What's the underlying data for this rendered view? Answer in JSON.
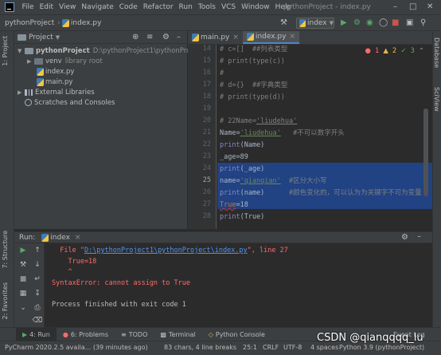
{
  "menu": {
    "items": [
      "File",
      "Edit",
      "View",
      "Navigate",
      "Code",
      "Refactor",
      "Run",
      "Tools",
      "VCS",
      "Window",
      "Help"
    ],
    "window_title": "pythonProject - index.py"
  },
  "nav": {
    "project": "pythonProject",
    "file": "index.py",
    "run_config": "index"
  },
  "left_tabs": {
    "project": "1: Project",
    "structure": "7: Structure",
    "favorites": "2: Favorites"
  },
  "right_tabs": {
    "database": "Database",
    "sciview": "SciView"
  },
  "project_panel": {
    "title": "Project",
    "root_name": "pythonProject",
    "root_path": "D:\\pythonProject1\\pythonProject",
    "venv": "venv",
    "venv_note": "library root",
    "file1": "index.py",
    "file2": "main.py",
    "external": "External Libraries",
    "scratches": "Scratches and Consoles"
  },
  "editor": {
    "tabs": [
      "main.py",
      "index.py"
    ],
    "inspections": {
      "errors": "1",
      "warnings": "2",
      "weak": "3"
    },
    "line_numbers": [
      "14",
      "15",
      "16",
      "17",
      "18",
      "19",
      "20",
      "21",
      "22",
      "23",
      "24",
      "25",
      "26",
      "27",
      "28"
    ],
    "lines": {
      "l14a": "# c=[]  ",
      "l14b": "##列表类型",
      "l15a": "# ",
      "l15b": "print",
      "l15c": "(",
      "l15d": "type",
      "l15e": "(c))",
      "l16": "#",
      "l17a": "# d={}  ",
      "l17b": "##字典类型",
      "l18a": "# ",
      "l18b": "print",
      "l18c": "(",
      "l18d": "type",
      "l18e": "(d))",
      "l20a": "# 22Name=",
      "l20b": "'liudehua'",
      "l21a": "Name=",
      "l21b": "'liudehua'",
      "l21c": "   #不可以数字开头",
      "l22a": "print",
      "l22b": "(Name)",
      "l23": "_age=89",
      "l24a": "print",
      "l24b": "(_age)",
      "l25a": "name=",
      "l25b": "'qianqian'",
      "l25c": "  #区分大小写",
      "l26a": "print",
      "l26b": "(name)",
      "l26c": "      #颜色变化的，可以认为为关键字不可为变量",
      "l27a": "True",
      "l27b": "=18",
      "l28a": "print",
      "l28b": "(True)"
    }
  },
  "run_panel": {
    "label": "Run:",
    "tab": "index",
    "out1a": "  File \"",
    "out1b": "D:\\pythonProject1\\pythonProject\\index.py",
    "out1c": "\", line 27",
    "out2": "    True=18",
    "out3": "    ^",
    "out4": "SyntaxError: cannot assign to True",
    "out5": "Process finished with exit code 1"
  },
  "bottom_tabs": [
    "4: Run",
    "6: Problems",
    "TODO",
    "Terminal",
    "Python Console",
    "Event Log"
  ],
  "status": {
    "left": "PyCharm 2020.2.5 availa... (39 minutes ago)",
    "chars": "83 chars, 4 line breaks",
    "pos": "25:1",
    "crlf": "CRLF",
    "enc": "UTF-8",
    "indent": "4 spaces",
    "interp": "Python 3.9 (pythonProject)"
  },
  "watermark": "CSDN @qianqqqq_lu",
  "colors": {
    "accent": "#4a88c7",
    "selection": "#214283",
    "error": "#ff6b68"
  }
}
